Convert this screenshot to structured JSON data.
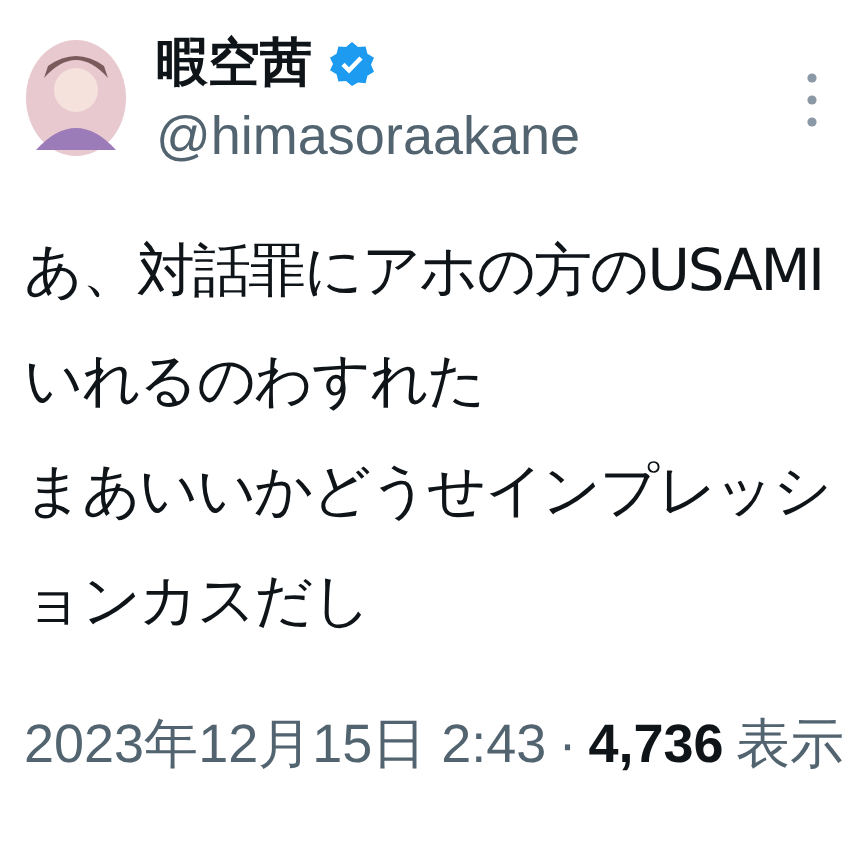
{
  "author": {
    "name": "暇空茜",
    "verified": true,
    "handle": "@himasoraakane"
  },
  "more_menu": true,
  "tweet": {
    "lines": [
      "あ、対話罪にアホの方のUSAMI",
      "いれるのわすれた",
      "まあいいかどうせインプレッシ",
      "ョンカスだし"
    ]
  },
  "meta": {
    "timestamp": "2023年12月15日 2:43",
    "separator": "·",
    "views": "4,736",
    "views_label": "表示"
  }
}
